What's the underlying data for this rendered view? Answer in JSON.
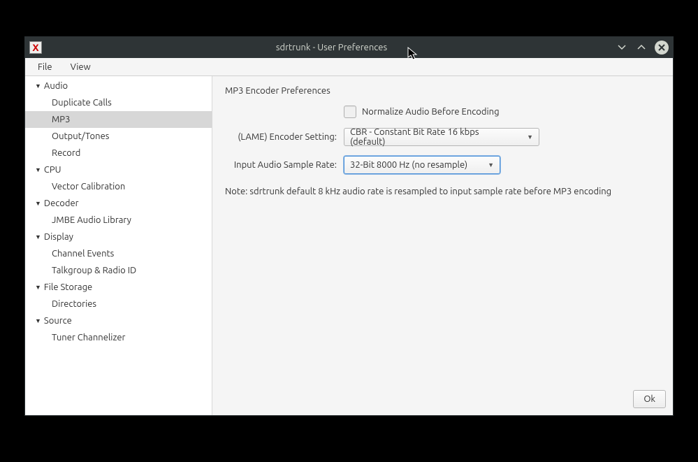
{
  "window": {
    "title": "sdrtrunk - User Preferences"
  },
  "menubar": {
    "file": "File",
    "view": "View"
  },
  "sidebar": {
    "categories": [
      {
        "label": "Audio",
        "items": [
          "Duplicate Calls",
          "MP3",
          "Output/Tones",
          "Record"
        ]
      },
      {
        "label": "CPU",
        "items": [
          "Vector Calibration"
        ]
      },
      {
        "label": "Decoder",
        "items": [
          "JMBE Audio Library"
        ]
      },
      {
        "label": "Display",
        "items": [
          "Channel Events",
          "Talkgroup & Radio ID"
        ]
      },
      {
        "label": "File Storage",
        "items": [
          "Directories"
        ]
      },
      {
        "label": "Source",
        "items": [
          "Tuner Channelizer"
        ]
      }
    ],
    "selected": "MP3"
  },
  "main": {
    "section_title": "MP3 Encoder Preferences",
    "normalize_label": "Normalize Audio Before Encoding",
    "encoder_label": "(LAME) Encoder Setting:",
    "encoder_value": "CBR - Constant Bit Rate 16 kbps (default)",
    "sample_rate_label": "Input Audio Sample Rate:",
    "sample_rate_value": "32-Bit 8000 Hz (no resample)",
    "note": "Note: sdrtrunk default 8 kHz audio rate is resampled to input sample rate before MP3 encoding"
  },
  "buttons": {
    "ok": "Ok"
  }
}
